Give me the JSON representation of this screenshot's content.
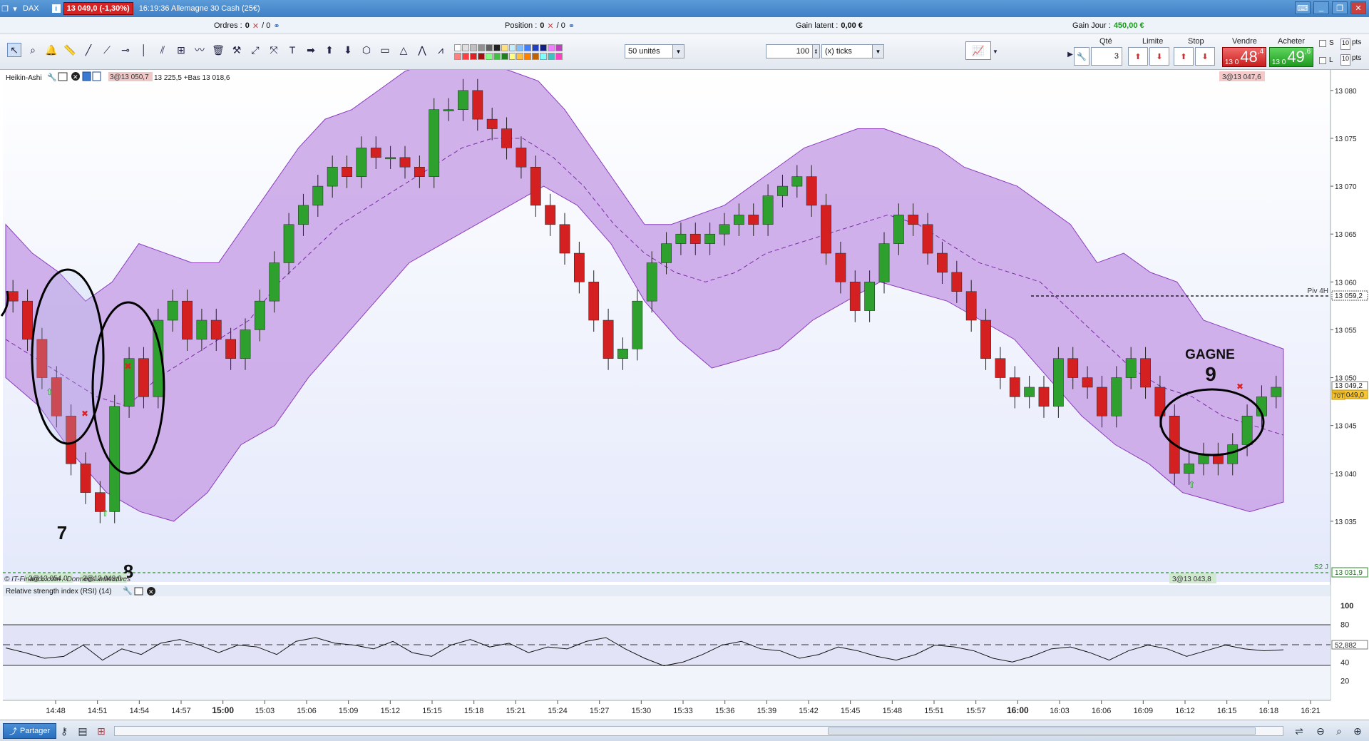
{
  "titlebar": {
    "instrument": "DAX",
    "price_badge": "13 049,0 (-1,30%)",
    "time_desc": "16:19:36 Allemagne 30 Cash (25€)"
  },
  "infobar": {
    "orders_label": "Ordres :",
    "orders_value": "0",
    "orders_total": "/ 0",
    "position_label": "Position :",
    "position_value": "0",
    "position_total": "/ 0",
    "latent_label": "Gain latent :",
    "latent_value": "0,00 €",
    "day_label": "Gain Jour :",
    "day_value": "450,00 €"
  },
  "toolbar": {
    "units_select": "50 unités",
    "ticks_value": "100",
    "ticks_select": "(x) ticks"
  },
  "order_panel": {
    "qty_label": "Qté",
    "qty_value": "3",
    "limit_label": "Limite",
    "stop_label": "Stop",
    "sell_label": "Vendre",
    "buy_label": "Acheter",
    "sell_prefix": "13 0",
    "sell_big": "48",
    "sell_small": ",4",
    "buy_prefix": "13 0",
    "buy_big": "49",
    "buy_small": ",6",
    "s_label": "S",
    "l_label": "L",
    "s_pts": "10",
    "l_pts": "10",
    "pts_label": "pts"
  },
  "main_chart": {
    "header_title": "Heikin-Ashi",
    "header_ohlc": "13 225,5 +Bas 13 018,6",
    "header_tag": "3@13 050,7",
    "right_tag_top": "3@13 047,6",
    "pivot_label": "Piv 4H",
    "pivot_value": "13 059,2",
    "s2_label": "S2 J",
    "s2_value": "13 031,9",
    "last_price": "13 049,2",
    "bid_price": "13 049,0",
    "ask_tag": "70T",
    "copyright": "© IT-Finance.com - Données indicatives",
    "tag_bottom_left": "3@13 054,0",
    "tag_bottom_mid": "3@13 049,0",
    "tag_bottom_right": "3@13 043,8",
    "annotation_gagne": "GAGNE",
    "annotation_9": "9",
    "annotation_7": "7",
    "annotation_8": "8",
    "colors": {
      "band": "#c9a3e6",
      "band_edge": "#8c3bbf",
      "up": "#2ea02e",
      "down": "#d42020"
    }
  },
  "rsi_panel": {
    "title": "Relative strength index (RSI) (14)",
    "value": "52,882"
  },
  "statusbar": {
    "share_label": "Partager"
  },
  "chart_data": [
    {
      "type": "line",
      "title": "Heikin-Ashi",
      "ylabel": "",
      "ylim": [
        13030,
        13082
      ],
      "y_ticks": [
        "13 080",
        "13 075",
        "13 070",
        "13 065",
        "13 060",
        "13 055",
        "13 050",
        "13 045",
        "13 040",
        "13 035"
      ],
      "x_ticks": [
        "14:48",
        "14:51",
        "14:54",
        "14:57",
        "15:00",
        "15:03",
        "15:06",
        "15:09",
        "15:12",
        "15:15",
        "15:18",
        "15:21",
        "15:24",
        "15:27",
        "15:30",
        "15:33",
        "15:36",
        "15:39",
        "15:42",
        "15:45",
        "15:48",
        "15:51",
        "15:57",
        "16:00",
        "16:03",
        "16:06",
        "16:09",
        "16:12",
        "16:15",
        "16:18",
        "16:21"
      ],
      "series": [
        {
          "name": "close",
          "values": [
            13058,
            13054,
            13050,
            13046,
            13041,
            13038,
            13036,
            13047,
            13052,
            13048,
            13056,
            13058,
            13054,
            13056,
            13054,
            13052,
            13055,
            13058,
            13062,
            13066,
            13068,
            13070,
            13072,
            13071,
            13074,
            13073,
            13073,
            13072,
            13071,
            13078,
            13078,
            13080,
            13077,
            13076,
            13074,
            13072,
            13068,
            13066,
            13063,
            13060,
            13056,
            13052,
            13053,
            13058,
            13062,
            13064,
            13065,
            13064,
            13065,
            13066,
            13067,
            13066,
            13069,
            13070,
            13071,
            13068,
            13063,
            13060,
            13057,
            13060,
            13064,
            13067,
            13066,
            13063,
            13061,
            13059,
            13056,
            13052,
            13050,
            13048,
            13049,
            13047,
            13052,
            13050,
            13049,
            13046,
            13050,
            13052,
            13049,
            13046,
            13040,
            13041,
            13042,
            13041,
            13043,
            13046,
            13048,
            13049
          ]
        },
        {
          "name": "bollinger_upper",
          "values": [
            13066,
            13063,
            13061,
            13058,
            13060,
            13064,
            13063,
            13062,
            13062,
            13066,
            13070,
            13074,
            13077,
            13078,
            13080,
            13082,
            13083,
            13083,
            13083,
            13082,
            13081,
            13078,
            13074,
            13070,
            13066,
            13066,
            13067,
            13068,
            13070,
            13072,
            13074,
            13075,
            13076,
            13076,
            13075,
            13074,
            13072,
            13071,
            13070,
            13068,
            13066,
            13062,
            13063,
            13061,
            13060,
            13056,
            13055,
            13054,
            13053
          ]
        },
        {
          "name": "bollinger_mid",
          "values": [
            13054,
            13052,
            13050,
            13048,
            13047,
            13050,
            13052,
            13054,
            13056,
            13060,
            13063,
            13066,
            13068,
            13070,
            13072,
            13074,
            13075,
            13075,
            13073,
            13070,
            13066,
            13063,
            13061,
            13060,
            13061,
            13063,
            13064,
            13065,
            13066,
            13067,
            13066,
            13064,
            13062,
            13061,
            13060,
            13057,
            13054,
            13051,
            13049,
            13048,
            13046,
            13045,
            13044
          ]
        },
        {
          "name": "bollinger_lower",
          "values": [
            13050,
            13047,
            13042,
            13038,
            13036,
            13035,
            13038,
            13043,
            13045,
            13050,
            13054,
            13058,
            13062,
            13064,
            13066,
            13068,
            13070,
            13068,
            13064,
            13058,
            13054,
            13051,
            13052,
            13053,
            13056,
            13058,
            13060,
            13059,
            13058,
            13056,
            13054,
            13050,
            13046,
            13043,
            13041,
            13038,
            13037,
            13036,
            13037
          ]
        }
      ]
    },
    {
      "type": "line",
      "title": "Relative strength index (RSI) (14)",
      "ylim": [
        0,
        110
      ],
      "y_ticks": [
        "100",
        "80",
        "60",
        "40",
        "20"
      ],
      "series": [
        {
          "name": "RSI",
          "values": [
            55,
            50,
            44,
            46,
            58,
            42,
            54,
            48,
            60,
            64,
            58,
            50,
            58,
            56,
            48,
            62,
            66,
            60,
            58,
            54,
            62,
            50,
            46,
            58,
            64,
            56,
            60,
            50,
            56,
            54,
            62,
            66,
            54,
            44,
            36,
            40,
            48,
            58,
            62,
            54,
            52,
            44,
            48,
            56,
            52,
            46,
            42,
            48,
            58,
            56,
            52,
            44,
            40,
            46,
            54,
            56,
            50,
            42,
            52,
            58,
            54,
            46,
            52,
            58,
            54,
            52,
            53
          ]
        }
      ]
    }
  ]
}
